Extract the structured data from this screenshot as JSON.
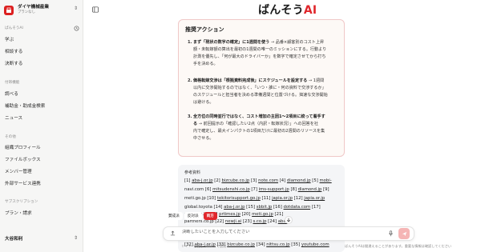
{
  "org": {
    "name": "ダイヤ機械産業",
    "plan": "プランなし"
  },
  "sidebar": {
    "section_main": "ぱんそうAI",
    "main_items": [
      {
        "label": "学ぶ"
      },
      {
        "label": "相談する"
      },
      {
        "label": "決断する"
      }
    ],
    "section_support": "付帯機能",
    "support_items": [
      {
        "label": "調べる"
      },
      {
        "label": "補助金・助成金検索"
      },
      {
        "label": "ニュース"
      }
    ],
    "section_other": "その他",
    "other_items": [
      {
        "label": "組織プロフィール"
      },
      {
        "label": "ファイルボックス"
      },
      {
        "label": "メンバー管理"
      },
      {
        "label": "外部サービス連携"
      }
    ],
    "section_sub": "サブスクリプション",
    "sub_items": [
      {
        "label": "プラン・請求"
      }
    ],
    "user": "大谷和利"
  },
  "brand": {
    "prefix": "ばんそう",
    "suffix": "AI",
    "accent": "#e0262b"
  },
  "recommend": {
    "title": "推奨アクション",
    "items": [
      {
        "num": "1.",
        "bold": "まず「現状の数字の確定」に1週間を使う",
        "lines": [
          "→ 品番×顧客別のコスト上昇",
          "額・未転嫁額の算出を最初の1週間の唯一のミッションにする。行動より",
          "計測を優先し、「何が最大のドライバーか」を数字で確定させてから打ち",
          "手を決める。"
        ]
      },
      {
        "num": "2.",
        "bold": "価格転嫁交渉は「根拠資料完成後」にスケジュールを設定する",
        "lines": [
          "→ 1週間",
          "以内に交渉開始するのではなく、「いつ・誰に・何の資料で交渉するか」",
          "のスケジュールと担当者を決める準備週間と位置づける。拙速な交渉開始",
          "は避ける。"
        ]
      },
      {
        "num": "3.",
        "bold": "全方位の同時並行ではなく、コスト増加の主因1〜2項目に絞って着手す",
        "lines": [
          "る",
          "→ 前回提示の「確認したい2点（内訳・転嫁状況）」への回答を社",
          "内で確定し、最大インパクトの1項目だけに最初の2週間のリソースを集",
          "中させる。"
        ]
      }
    ]
  },
  "references": {
    "title": "参考資料",
    "lines": [
      "[1] aba-j.or.jp [2] bizcube.co.jp [3] note.com [4] diamond.jp [5] mobi-",
      "navi.com [6] mitsudenshi.co.jp [7] ims-support.jp [8] diamond.jp [9]",
      "meti.go.jp [10] tekitorisupport.go.jp [11] japia.or.jp [12] japia.or.jp",
      "global.toyota [14] aba-j.or.jp [15] sbbit.jp [16] dotdata.com [17]",
      "                    up-cycle.jp [19] prtimes.jp [20] meti.go.jp [21]",
      "                    partners.co.jp [22] newji.ai [23]           s.co.jp [24] aba-",
      "[32] aba-j.or.jp [33] bizcube.co.jp [34] nittsu.co.jp [35] youtube.com"
    ]
  },
  "modes": {
    "items": [
      "賛成派",
      "反対派",
      "両方"
    ],
    "active_index": 2
  },
  "input": {
    "placeholder": "決断したいことを入力してください",
    "hint_left": "⇧ + ↵ で改行 · Enter で送信",
    "hint_right": "ぱんそうAIは間違えることがあります。重要な情報は確認してください"
  }
}
